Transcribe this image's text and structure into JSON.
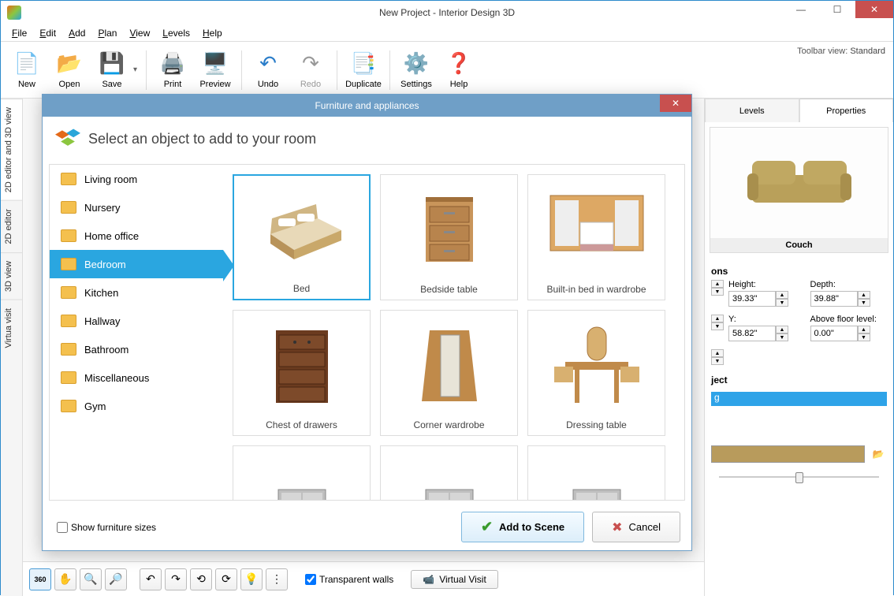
{
  "window": {
    "title": "New Project - Interior Design 3D"
  },
  "menubar": [
    "File",
    "Edit",
    "Add",
    "Plan",
    "View",
    "Levels",
    "Help"
  ],
  "toolbar": {
    "items": [
      {
        "label": "New",
        "icon": "file"
      },
      {
        "label": "Open",
        "icon": "open"
      },
      {
        "label": "Save",
        "icon": "save",
        "split": true
      },
      {
        "sep": true
      },
      {
        "label": "Print",
        "icon": "print"
      },
      {
        "label": "Preview",
        "icon": "preview"
      },
      {
        "sep": true
      },
      {
        "label": "Undo",
        "icon": "undo"
      },
      {
        "label": "Redo",
        "icon": "redo",
        "disabled": true
      },
      {
        "sep": true
      },
      {
        "label": "Duplicate",
        "icon": "duplicate"
      },
      {
        "sep": true
      },
      {
        "label": "Settings",
        "icon": "settings"
      },
      {
        "label": "Help",
        "icon": "help"
      }
    ],
    "view_label": "Toolbar view:",
    "view_mode": "Standard"
  },
  "left_tabs": [
    "2D editor and 3D view",
    "2D editor",
    "3D view",
    "Virtua visit"
  ],
  "right_tabs": {
    "levels": "Levels",
    "properties": "Properties"
  },
  "properties": {
    "preview_label": "Couch",
    "section_dimensions": "ons",
    "height_label": "Height:",
    "height_value": "39.33\"",
    "depth_label": "Depth:",
    "depth_value": "39.88\"",
    "y_label": "Y:",
    "y_value": "58.82\"",
    "above_label": "Above floor level:",
    "above_value": "0.00\"",
    "obj_section": "ject",
    "selected_text": "g"
  },
  "bottom": {
    "transparent_walls": "Transparent walls",
    "virtual_visit": "Virtual Visit"
  },
  "dialog": {
    "title": "Furniture and appliances",
    "heading": "Select an object to add to your room",
    "show_sizes": "Show furniture sizes",
    "add_btn": "Add to Scene",
    "cancel_btn": "Cancel",
    "categories": [
      {
        "name": "Living room"
      },
      {
        "name": "Nursery"
      },
      {
        "name": "Home office"
      },
      {
        "name": "Bedroom",
        "active": true
      },
      {
        "name": "Kitchen"
      },
      {
        "name": "Hallway"
      },
      {
        "name": "Bathroom"
      },
      {
        "name": "Miscellaneous"
      },
      {
        "name": "Gym"
      }
    ],
    "items": [
      {
        "name": "Bed",
        "selected": true,
        "icon": "bed"
      },
      {
        "name": "Bedside table",
        "icon": "nightstand"
      },
      {
        "name": "Built-in bed in wardrobe",
        "icon": "wardrobe-bed"
      },
      {
        "name": "Chest of drawers",
        "icon": "dresser"
      },
      {
        "name": "Corner wardrobe",
        "icon": "corner-wardrobe"
      },
      {
        "name": "Dressing table",
        "icon": "vanity"
      },
      {
        "name": "",
        "icon": "cabinet1"
      },
      {
        "name": "",
        "icon": "cabinet2"
      },
      {
        "name": "",
        "icon": "cabinet3"
      }
    ]
  }
}
